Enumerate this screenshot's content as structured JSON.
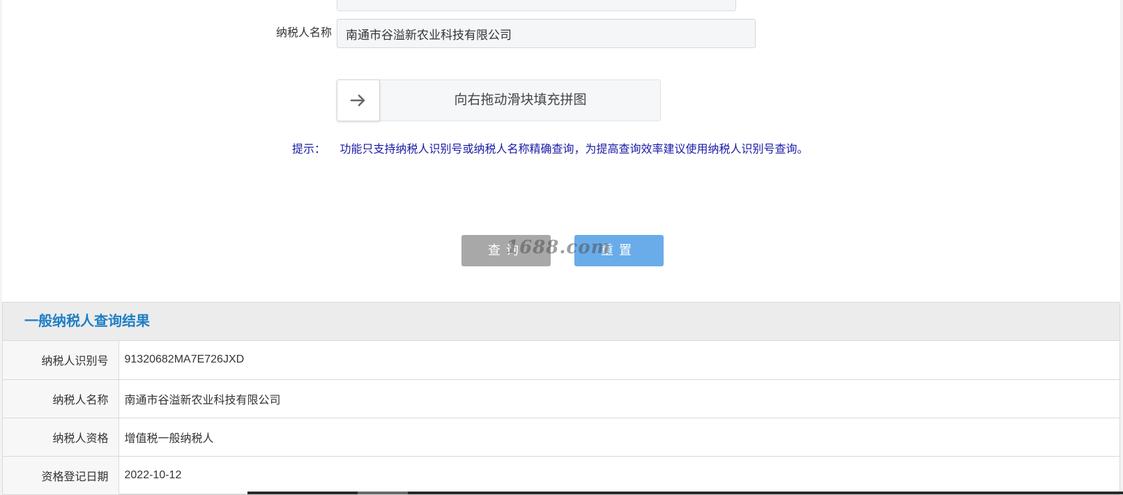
{
  "form": {
    "name_label": "纳税人名称",
    "name_value": "南通市谷溢新农业科技有限公司"
  },
  "slider": {
    "text": "向右拖动滑块填充拼图",
    "handle_icon": "arrow-right-icon"
  },
  "tip": {
    "label": "提示：",
    "text": "功能只支持纳税人识别号或纳税人名称精确查询，为提高查询效率建议使用纳税人识别号查询。"
  },
  "buttons": {
    "query_label": "查询",
    "reset_label": "重置"
  },
  "watermark": "1688.com",
  "result": {
    "title": "一般纳税人查询结果",
    "rows": [
      {
        "label": "纳税人识别号",
        "value": "91320682MA7E726JXD"
      },
      {
        "label": "纳税人名称",
        "value": "南通市谷溢新农业科技有限公司"
      },
      {
        "label": "纳税人资格",
        "value": "增值税一般纳税人"
      },
      {
        "label": "资格登记日期",
        "value": "2022-10-12"
      }
    ]
  },
  "colors": {
    "tip_text": "#1a1aa6",
    "result_title": "#1e7fc5",
    "query_button": "#a8a8a8",
    "reset_button": "#6aace9"
  }
}
